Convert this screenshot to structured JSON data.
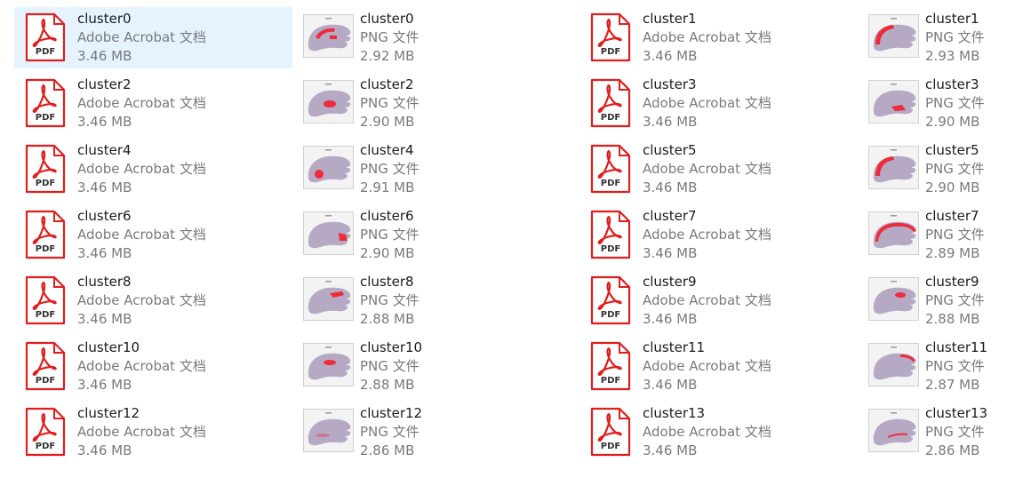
{
  "colors": {
    "selection": "#e5f3ff",
    "pdf_red": "#e01e1e",
    "thumb_tissue": "#b5a9c4",
    "thumb_highlight": "#ee2b3b"
  },
  "icons": {
    "pdf": "pdf-file-icon",
    "png": "png-thumbnail-icon"
  },
  "pdf_badge": "PDF",
  "selected_index": 0,
  "files": [
    {
      "name": "cluster0",
      "kind": "pdf",
      "type": "Adobe Acrobat 文档",
      "size": "3.46 MB"
    },
    {
      "name": "cluster0",
      "kind": "png",
      "type": "PNG 文件",
      "size": "2.92 MB",
      "highlight": "upper-arc"
    },
    {
      "name": "cluster1",
      "kind": "pdf",
      "type": "Adobe Acrobat 文档",
      "size": "3.46 MB"
    },
    {
      "name": "cluster1",
      "kind": "png",
      "type": "PNG 文件",
      "size": "2.93 MB",
      "highlight": "outer-band"
    },
    {
      "name": "cluster2",
      "kind": "pdf",
      "type": "Adobe Acrobat 文档",
      "size": "3.46 MB"
    },
    {
      "name": "cluster2",
      "kind": "png",
      "type": "PNG 文件",
      "size": "2.90 MB",
      "highlight": "center"
    },
    {
      "name": "cluster3",
      "kind": "pdf",
      "type": "Adobe Acrobat 文档",
      "size": "3.46 MB"
    },
    {
      "name": "cluster3",
      "kind": "png",
      "type": "PNG 文件",
      "size": "2.90 MB",
      "highlight": "lower-middle"
    },
    {
      "name": "cluster4",
      "kind": "pdf",
      "type": "Adobe Acrobat 文档",
      "size": "3.46 MB"
    },
    {
      "name": "cluster4",
      "kind": "png",
      "type": "PNG 文件",
      "size": "2.91 MB",
      "highlight": "left-lower"
    },
    {
      "name": "cluster5",
      "kind": "pdf",
      "type": "Adobe Acrobat 文档",
      "size": "3.46 MB"
    },
    {
      "name": "cluster5",
      "kind": "png",
      "type": "PNG 文件",
      "size": "2.90 MB",
      "highlight": "outer-band"
    },
    {
      "name": "cluster6",
      "kind": "pdf",
      "type": "Adobe Acrobat 文档",
      "size": "3.46 MB"
    },
    {
      "name": "cluster6",
      "kind": "png",
      "type": "PNG 文件",
      "size": "2.90 MB",
      "highlight": "right"
    },
    {
      "name": "cluster7",
      "kind": "pdf",
      "type": "Adobe Acrobat 文档",
      "size": "3.46 MB"
    },
    {
      "name": "cluster7",
      "kind": "png",
      "type": "PNG 文件",
      "size": "2.89 MB",
      "highlight": "outline"
    },
    {
      "name": "cluster8",
      "kind": "pdf",
      "type": "Adobe Acrobat 文档",
      "size": "3.46 MB"
    },
    {
      "name": "cluster8",
      "kind": "png",
      "type": "PNG 文件",
      "size": "2.88 MB",
      "highlight": "upper-right"
    },
    {
      "name": "cluster9",
      "kind": "pdf",
      "type": "Adobe Acrobat 文档",
      "size": "3.46 MB"
    },
    {
      "name": "cluster9",
      "kind": "png",
      "type": "PNG 文件",
      "size": "2.88 MB",
      "highlight": "upper-center"
    },
    {
      "name": "cluster10",
      "kind": "pdf",
      "type": "Adobe Acrobat 文档",
      "size": "3.46 MB"
    },
    {
      "name": "cluster10",
      "kind": "png",
      "type": "PNG 文件",
      "size": "2.88 MB",
      "highlight": "center-top"
    },
    {
      "name": "cluster11",
      "kind": "pdf",
      "type": "Adobe Acrobat 文档",
      "size": "3.46 MB"
    },
    {
      "name": "cluster11",
      "kind": "png",
      "type": "PNG 文件",
      "size": "2.87 MB",
      "highlight": "top-edge"
    },
    {
      "name": "cluster12",
      "kind": "pdf",
      "type": "Adobe Acrobat 文档",
      "size": "3.46 MB"
    },
    {
      "name": "cluster12",
      "kind": "png",
      "type": "PNG 文件",
      "size": "2.86 MB",
      "highlight": "faint"
    },
    {
      "name": "cluster13",
      "kind": "pdf",
      "type": "Adobe Acrobat 文档",
      "size": "3.46 MB"
    },
    {
      "name": "cluster13",
      "kind": "png",
      "type": "PNG 文件",
      "size": "2.86 MB",
      "highlight": "mid-line"
    }
  ]
}
